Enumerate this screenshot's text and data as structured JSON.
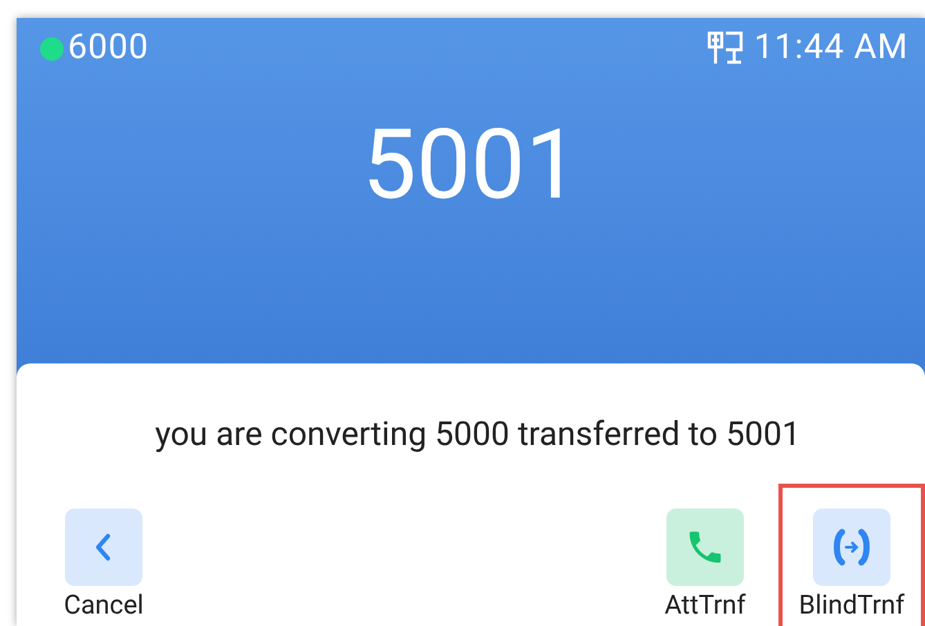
{
  "status_bar": {
    "account": "6000",
    "registered": true,
    "time": "11:44 AM"
  },
  "call": {
    "number": "5001"
  },
  "dialog": {
    "message": "you are converting 5000 transferred to 5001",
    "actions": [
      {
        "label": "Cancel",
        "kind": "back",
        "highlighted": false
      },
      {
        "label": "AttTrnf",
        "kind": "attended",
        "highlighted": false
      },
      {
        "label": "BlindTrnf",
        "kind": "blind",
        "highlighted": true
      }
    ]
  }
}
